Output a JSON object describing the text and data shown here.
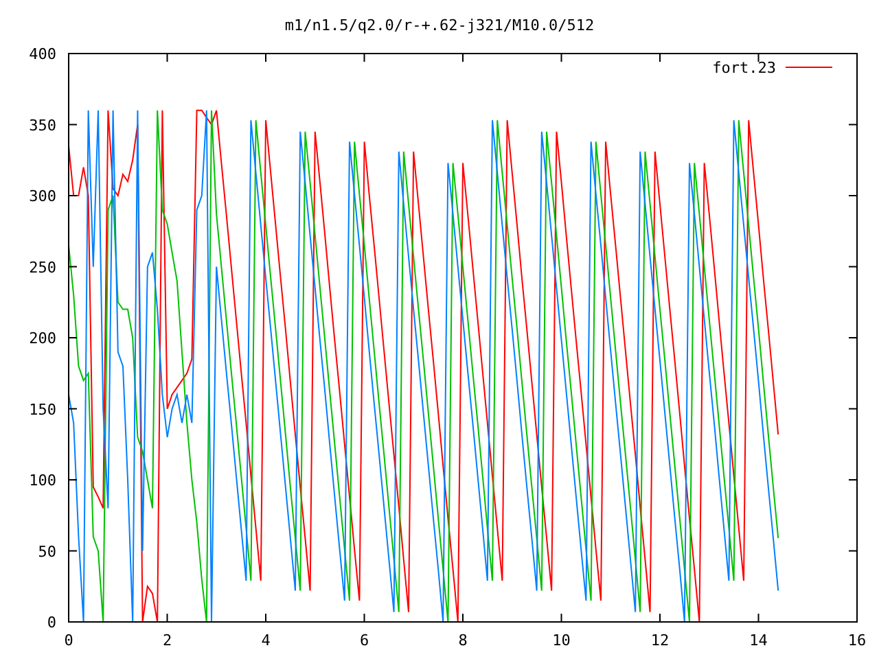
{
  "chart_data": {
    "type": "line",
    "title": "m1/n1.5/q2.0/r-+.62-j321/M10.0/512",
    "xlim": [
      0,
      16
    ],
    "ylim": [
      0,
      400
    ],
    "xticks": [
      0,
      2,
      4,
      6,
      8,
      10,
      12,
      14,
      16
    ],
    "yticks": [
      0,
      50,
      100,
      150,
      200,
      250,
      300,
      350,
      400
    ],
    "x": [
      0,
      0.1,
      0.2,
      0.3,
      0.4,
      0.5,
      0.6,
      0.7,
      0.8,
      0.9,
      1,
      1.1,
      1.2,
      1.3,
      1.4,
      1.5,
      1.6,
      1.7,
      1.8,
      1.9,
      2,
      2.1,
      2.2,
      2.3,
      2.4,
      2.5,
      2.6,
      2.7,
      2.8,
      2.9,
      3,
      3.1,
      3.2,
      3.3,
      3.4,
      3.5,
      3.6,
      3.7,
      3.8,
      3.9,
      4,
      4.1,
      4.2,
      4.3,
      4.4,
      4.5,
      4.6,
      4.7,
      4.8,
      4.9,
      5,
      5.1,
      5.2,
      5.3,
      5.4,
      5.5,
      5.6,
      5.7,
      5.8,
      5.9,
      6,
      6.1,
      6.2,
      6.3,
      6.4,
      6.5,
      6.6,
      6.7,
      6.8,
      6.9,
      7,
      7.1,
      7.2,
      7.3,
      7.4,
      7.5,
      7.6,
      7.7,
      7.8,
      7.9,
      8,
      8.1,
      8.2,
      8.3,
      8.4,
      8.5,
      8.6,
      8.7,
      8.8,
      8.9,
      9,
      9.1,
      9.2,
      9.3,
      9.4,
      9.5,
      9.6,
      9.7,
      9.8,
      9.9,
      10,
      10.1,
      10.2,
      10.3,
      10.4,
      10.5,
      10.6,
      10.7,
      10.8,
      10.9,
      11,
      11.1,
      11.2,
      11.3,
      11.4,
      11.5,
      11.6,
      11.7,
      11.8,
      11.9,
      12,
      12.1,
      12.2,
      12.3,
      12.4,
      12.5,
      12.6,
      12.7,
      12.8,
      12.9,
      13,
      13.1,
      13.2,
      13.3,
      13.4,
      13.5,
      13.6,
      13.7,
      13.8,
      13.9,
      14,
      14.1,
      14.2,
      14.3,
      14.4
    ],
    "series": [
      {
        "name": "fort.23",
        "color": "#ff0000",
        "values": [
          335,
          300,
          300,
          320,
          300,
          95,
          88,
          80,
          360,
          305,
          300,
          315,
          310,
          325,
          350,
          0,
          25,
          20,
          0,
          360,
          150,
          160,
          165,
          170,
          175,
          185,
          360,
          360,
          355,
          350,
          360,
          323,
          287,
          250,
          213,
          176,
          140,
          103,
          66,
          29,
          353,
          316,
          279,
          242,
          206,
          169,
          132,
          95,
          59,
          22,
          345,
          309,
          272,
          235,
          198,
          162,
          125,
          88,
          51,
          15,
          338,
          301,
          265,
          228,
          191,
          154,
          118,
          81,
          44,
          7,
          331,
          294,
          257,
          220,
          184,
          147,
          110,
          73,
          37,
          0,
          323,
          287,
          250,
          213,
          176,
          140,
          103,
          66,
          29,
          353,
          316,
          279,
          242,
          206,
          169,
          132,
          95,
          59,
          22,
          345,
          309,
          272,
          235,
          198,
          162,
          125,
          88,
          51,
          15,
          338,
          301,
          265,
          228,
          191,
          154,
          118,
          81,
          44,
          7,
          331,
          294,
          257,
          220,
          184,
          147,
          110,
          73,
          37,
          0,
          323,
          287,
          250,
          213,
          176,
          140,
          103,
          66,
          29,
          353,
          316,
          279,
          242,
          206,
          169,
          132
        ]
      },
      {
        "color": "#00c000",
        "values": [
          265,
          230,
          180,
          170,
          175,
          60,
          50,
          0,
          290,
          300,
          225,
          220,
          220,
          200,
          130,
          120,
          100,
          80,
          360,
          290,
          280,
          260,
          240,
          190,
          140,
          100,
          70,
          30,
          0,
          360,
          287,
          250,
          213,
          176,
          140,
          103,
          66,
          29,
          353,
          316,
          279,
          242,
          206,
          169,
          132,
          95,
          59,
          22,
          345,
          309,
          272,
          235,
          198,
          162,
          125,
          88,
          51,
          15,
          338,
          301,
          265,
          228,
          191,
          154,
          118,
          81,
          44,
          7,
          331,
          294,
          257,
          220,
          184,
          147,
          110,
          73,
          37,
          0,
          323,
          287,
          250,
          213,
          176,
          140,
          103,
          66,
          29,
          353,
          316,
          279,
          242,
          206,
          169,
          132,
          95,
          59,
          22,
          345,
          309,
          272,
          235,
          198,
          162,
          125,
          88,
          51,
          15,
          338,
          301,
          265,
          228,
          191,
          154,
          118,
          81,
          44,
          7,
          331,
          294,
          257,
          220,
          184,
          147,
          110,
          73,
          37,
          0,
          323,
          287,
          250,
          213,
          176,
          140,
          103,
          66,
          29,
          353,
          316,
          279,
          242,
          206,
          169,
          132,
          95,
          59
        ]
      },
      {
        "color": "#0080ff",
        "values": [
          160,
          140,
          60,
          0,
          360,
          250,
          360,
          150,
          80,
          360,
          190,
          180,
          100,
          0,
          360,
          50,
          250,
          260,
          220,
          160,
          130,
          150,
          160,
          140,
          160,
          140,
          290,
          300,
          360,
          0,
          250,
          213,
          176,
          140,
          103,
          66,
          29,
          353,
          316,
          279,
          242,
          206,
          169,
          132,
          95,
          59,
          22,
          345,
          309,
          272,
          235,
          198,
          162,
          125,
          88,
          51,
          15,
          338,
          301,
          265,
          228,
          191,
          154,
          118,
          81,
          44,
          7,
          331,
          294,
          257,
          220,
          184,
          147,
          110,
          73,
          37,
          0,
          323,
          287,
          250,
          213,
          176,
          140,
          103,
          66,
          29,
          353,
          316,
          279,
          242,
          206,
          169,
          132,
          95,
          59,
          22,
          345,
          309,
          272,
          235,
          198,
          162,
          125,
          88,
          51,
          15,
          338,
          301,
          265,
          228,
          191,
          154,
          118,
          81,
          44,
          7,
          331,
          294,
          257,
          220,
          184,
          147,
          110,
          73,
          37,
          0,
          323,
          287,
          250,
          213,
          176,
          140,
          103,
          66,
          29,
          353,
          316,
          279,
          242,
          206,
          169,
          132,
          95,
          59,
          22
        ]
      }
    ]
  }
}
